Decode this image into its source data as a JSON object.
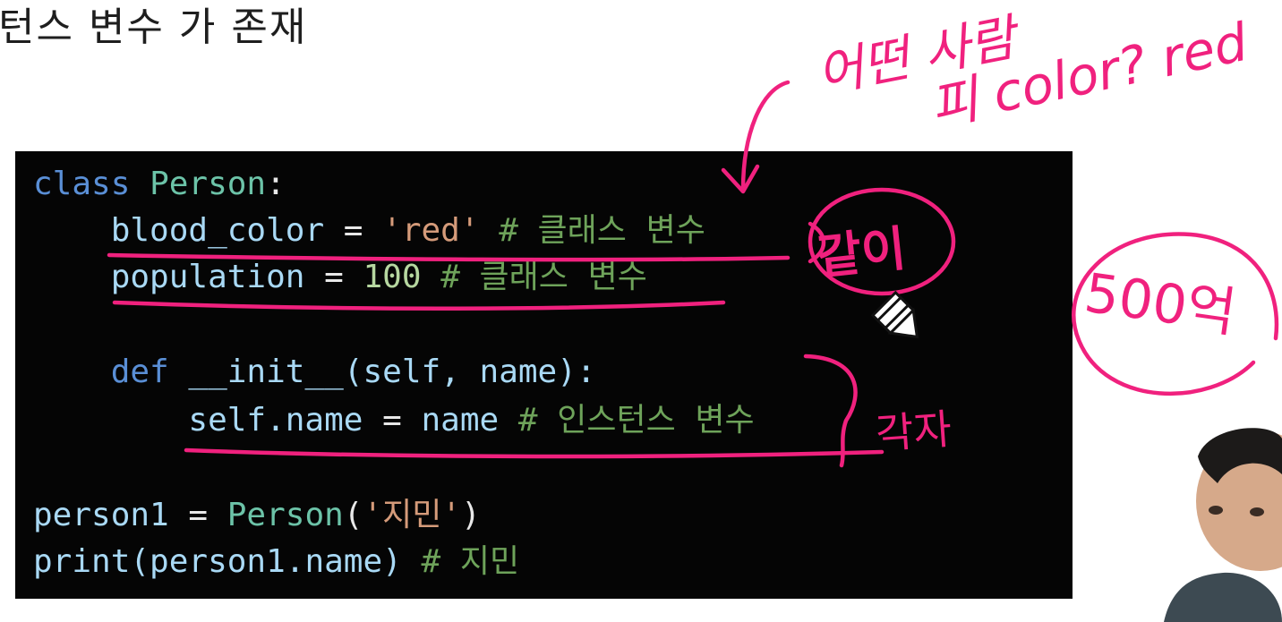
{
  "slide": {
    "title": "턴스 변수 가 존재"
  },
  "code": {
    "line1": {
      "kw": "class",
      "name": "Person",
      "colon": ":"
    },
    "line2": {
      "indent": "    ",
      "var": "blood_color",
      "eq": " = ",
      "str": "'red'",
      "cmt": " # 클래스 변수"
    },
    "line3": {
      "indent": "    ",
      "var": "population",
      "eq": " = ",
      "num": "100",
      "cmt": " # 클래스 변수"
    },
    "line5": {
      "indent": "    ",
      "kw": "def",
      "fn": " __init__",
      "args": "(self, name):"
    },
    "line6": {
      "indent": "        ",
      "var": "self.name",
      "eq": " = ",
      "val": "name",
      "cmt": " # 인스턴스 변수"
    },
    "line8": {
      "var": "person1",
      "eq": " = ",
      "cls": "Person",
      "open": "(",
      "str": "'지민'",
      "close": ")"
    },
    "line9": {
      "fn": "print",
      "args": "(person1.name)",
      "cmt": " # 지민"
    }
  },
  "annotations": {
    "note1": "어떤 사람",
    "note2": "피 color? red",
    "note3": "같이",
    "note4": "500억",
    "note5": "각자"
  },
  "colors": {
    "ink": "#f0217e",
    "keyword": "#5a8fd6",
    "class_name": "#6cc3a8",
    "variable": "#a9d9f5",
    "string": "#d59b7a",
    "number": "#b6d7a0",
    "comment": "#6ea35a",
    "code_bg": "#050505"
  },
  "icons": {
    "cursor": "pencil-cursor-icon"
  }
}
